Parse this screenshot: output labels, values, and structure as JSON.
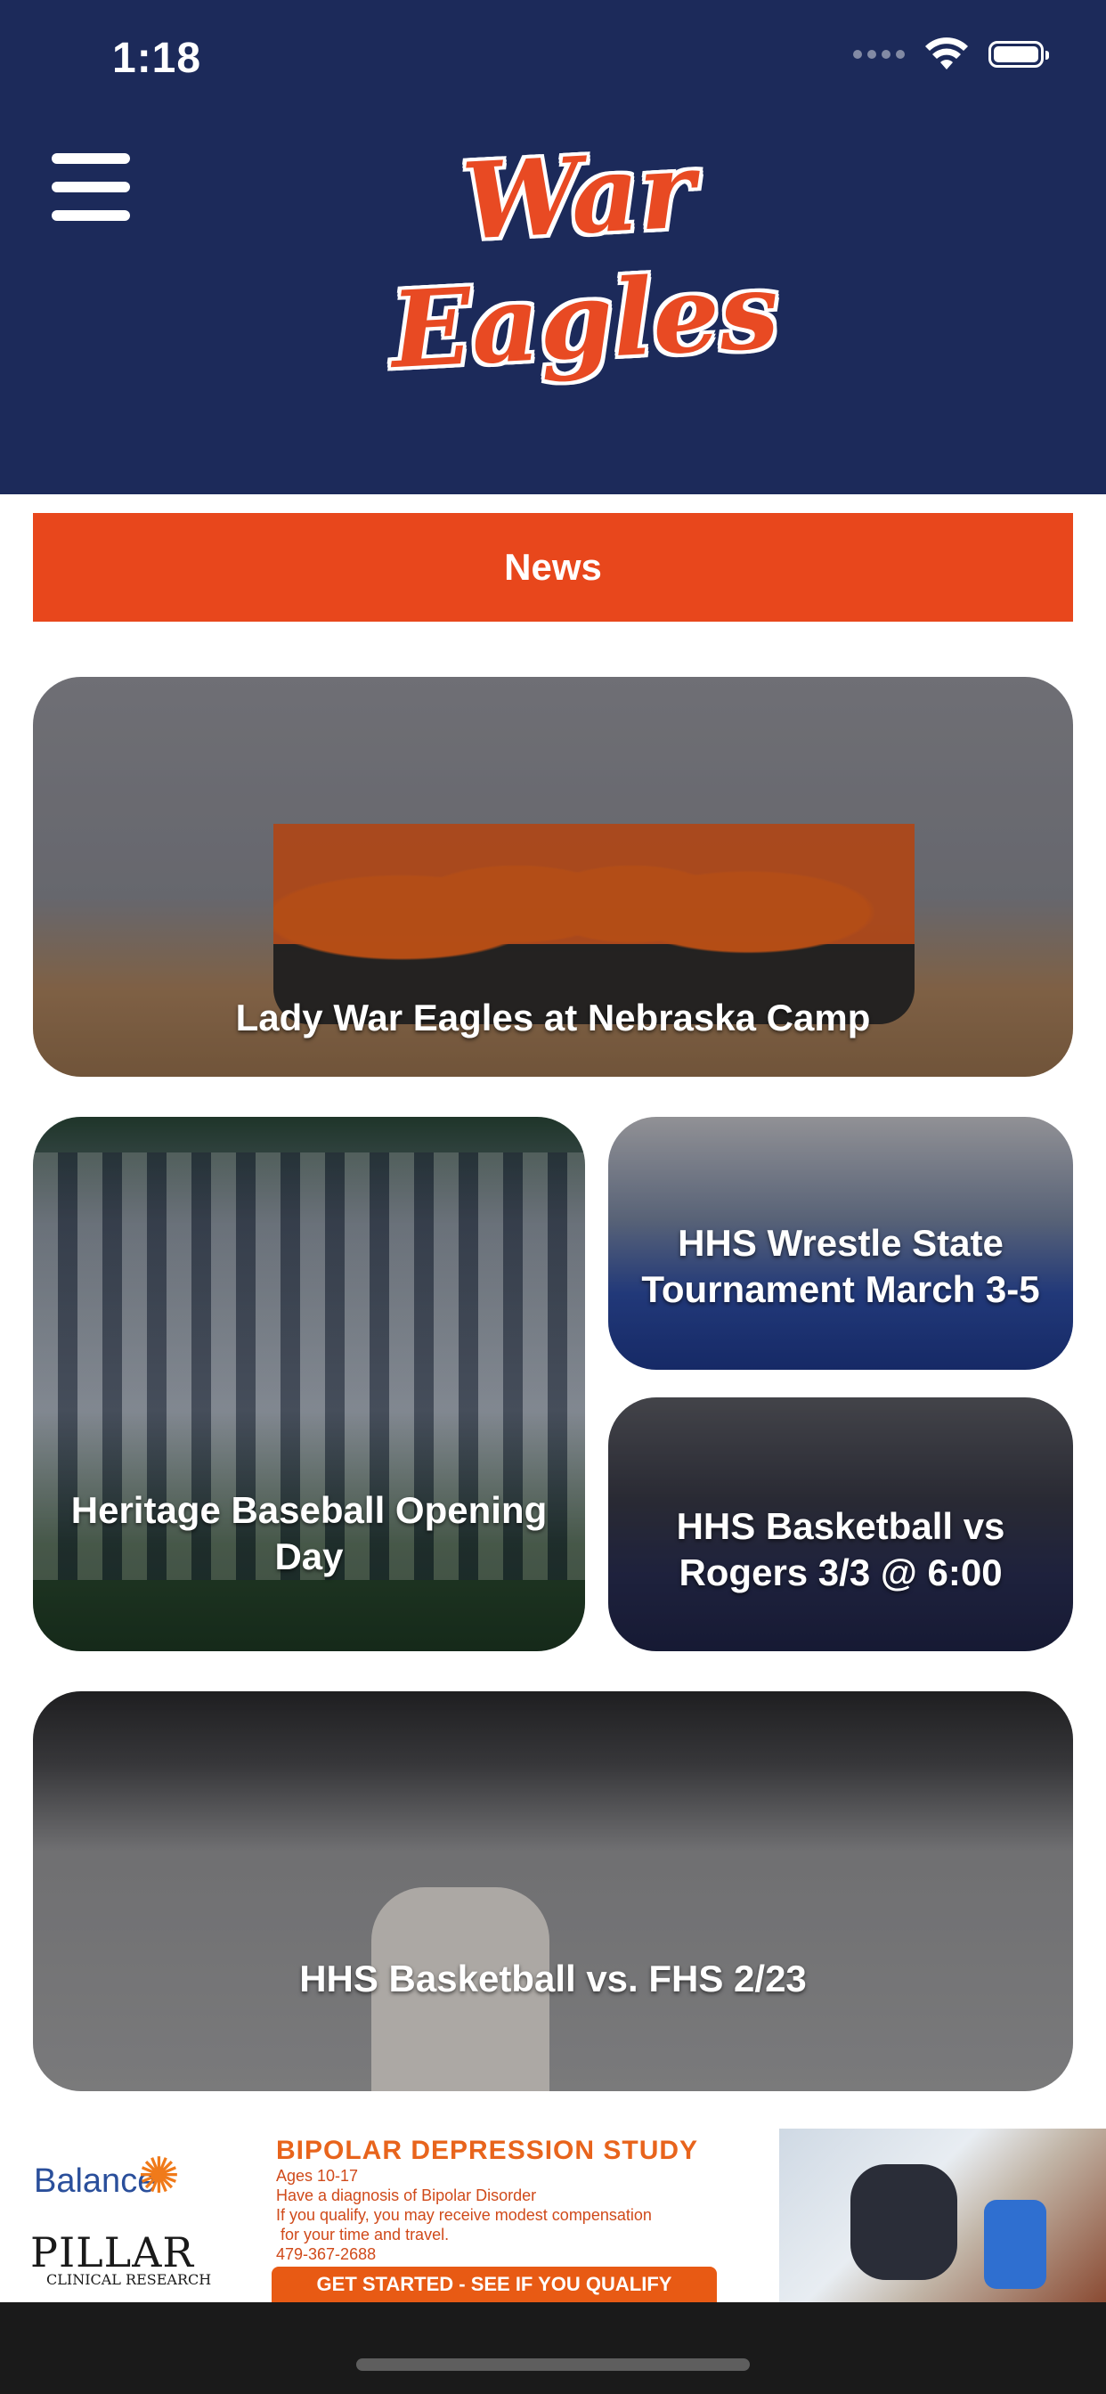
{
  "status_bar": {
    "time": "1:18"
  },
  "header": {
    "logo_text": "War Eagles"
  },
  "section": {
    "title": "News"
  },
  "cards": [
    {
      "title": "Lady War Eagles at Nebraska Camp"
    },
    {
      "title": "Heritage Baseball Opening Day"
    },
    {
      "title": "HHS Wrestle State Tournament March 3-5"
    },
    {
      "title": "HHS Basketball vs Rogers 3/3 @ 6:00"
    },
    {
      "title": "HHS Basketball vs. FHS 2/23"
    }
  ],
  "ad": {
    "brand_top": "Balance",
    "brand_bottom": "PILLAR",
    "brand_bottom_sub": "CLINICAL RESEARCH",
    "heading": "BIPOLAR DEPRESSION STUDY",
    "lines": [
      "Ages 10-17",
      "Have a diagnosis of Bipolar Disorder",
      "If you qualify, you may receive modest compensation",
      " for your time and travel.",
      "479-367-2688"
    ],
    "cta": "GET STARTED - SEE IF YOU QUALIFY"
  },
  "colors": {
    "header_bg": "#1c2a5a",
    "accent": "#e8471c"
  }
}
